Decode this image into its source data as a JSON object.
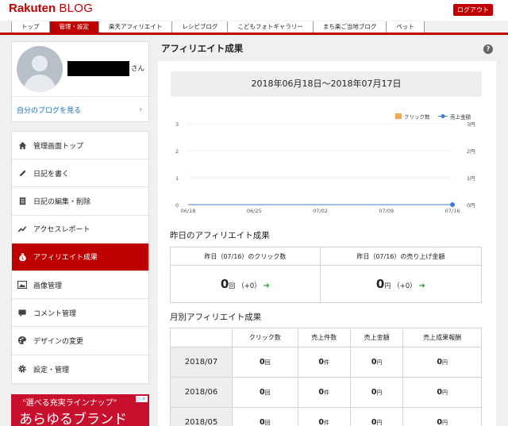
{
  "header": {
    "logo_rakuten": "Rakuten",
    "logo_blog": "BLOG",
    "logout_label": "ログアウト",
    "nav": [
      "トップ",
      "管理・設定",
      "楽天アフィリエイト",
      "レシピブログ",
      "こどもフォトギャラリー",
      "まち楽ご当地ブログ",
      "ペット"
    ],
    "active_nav": "管理・設定"
  },
  "profile": {
    "honorific": "さん",
    "my_blog_link": "自分のブログを見る",
    "chevron": "›"
  },
  "menu": {
    "items": [
      {
        "label": "管理画面トップ",
        "icon": "home-icon"
      },
      {
        "label": "日記を書く",
        "icon": "pencil-icon"
      },
      {
        "label": "日記の編集・削除",
        "icon": "document-icon"
      },
      {
        "label": "アクセスレポート",
        "icon": "trend-chart-icon"
      },
      {
        "label": "アフィリエイト成果",
        "icon": "money-bag-icon"
      },
      {
        "label": "画像管理",
        "icon": "image-icon"
      },
      {
        "label": "コメント管理",
        "icon": "comment-icon"
      },
      {
        "label": "デザインの変更",
        "icon": "palette-icon"
      },
      {
        "label": "設定・管理",
        "icon": "gear-icon"
      }
    ],
    "active": "アフィリエイト成果"
  },
  "ad": {
    "line1": "\"選べる充実ラインナップ\"",
    "line2": "あらゆるブランド"
  },
  "main": {
    "title": "アフィリエイト成果",
    "help_icon": "?",
    "date_range": "2018年06月18日～2018年07月17日",
    "yesterday_title": "昨日のアフィリエイト成果",
    "yesterday": {
      "clicks_header": "昨日（07/16）のクリック数",
      "sales_header": "昨日（07/16）の売り上げ金額",
      "clicks_value": "0",
      "clicks_unit": "回",
      "clicks_change": "（+0）",
      "sales_value": "0",
      "sales_unit": "円",
      "sales_change": "（+0）",
      "arrow": "➜"
    },
    "monthly_title": "月別アフィリエイト成果",
    "monthly": {
      "headers": [
        "",
        "クリック数",
        "売上件数",
        "売上金額",
        "売上成果報酬"
      ],
      "units": [
        "回",
        "件",
        "円",
        "円"
      ],
      "rows": [
        {
          "month": "2018/07",
          "values": [
            "0",
            "0",
            "0",
            "0"
          ]
        },
        {
          "month": "2018/06",
          "values": [
            "0",
            "0",
            "0",
            "0"
          ]
        },
        {
          "month": "2018/05",
          "values": [
            "0",
            "0",
            "0",
            "0"
          ]
        }
      ]
    }
  },
  "colors": {
    "brand_red": "#bf0000",
    "click_series": "#f5a54a",
    "sales_series": "#3a7fd5",
    "up_arrow": "#2e9e3e"
  },
  "chart_data": {
    "type": "line",
    "categories": [
      "06/18",
      "06/25",
      "07/02",
      "07/09",
      "07/16"
    ],
    "series": [
      {
        "name": "クリック数",
        "values": [
          0,
          0,
          0,
          0,
          0
        ],
        "axis": "left"
      },
      {
        "name": "売上金額",
        "values": [
          0,
          0,
          0,
          0,
          0
        ],
        "axis": "right"
      }
    ],
    "y_left_ticks": [
      "3",
      "2",
      "1",
      "0"
    ],
    "y_right_ticks": [
      "3円",
      "2円",
      "1円",
      "0円"
    ],
    "ylim": [
      0,
      3
    ],
    "grid": true,
    "legend": "top-right"
  }
}
